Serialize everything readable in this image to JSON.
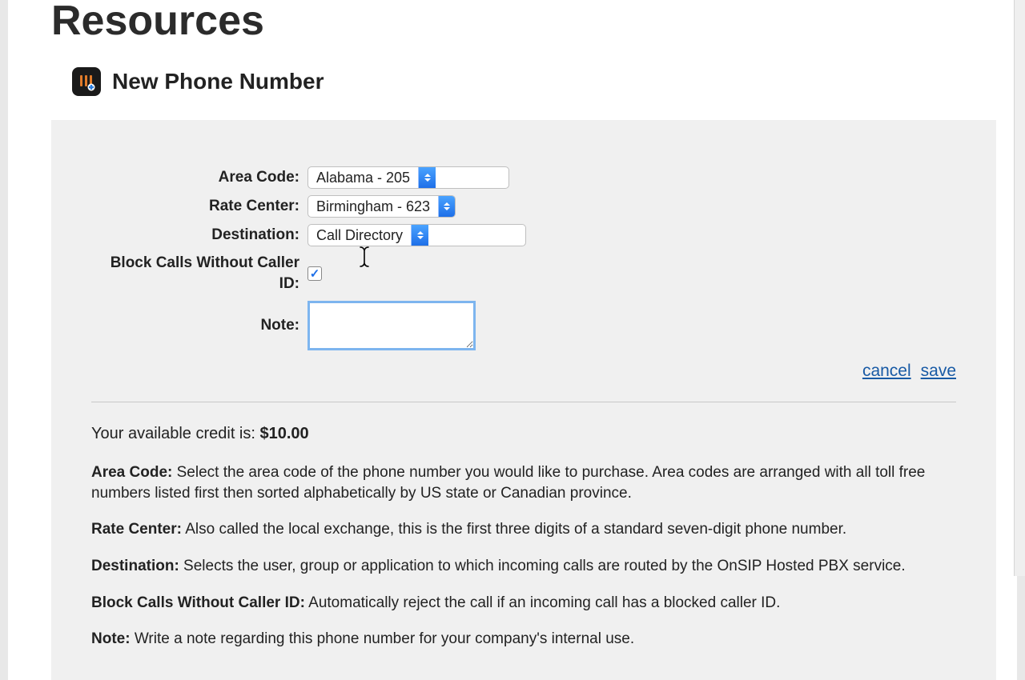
{
  "pageTitle": "Resources",
  "subtitle": "New Phone Number",
  "form": {
    "areaCode": {
      "label": "Area Code:",
      "value": "Alabama - 205"
    },
    "rateCenter": {
      "label": "Rate Center:",
      "value": "Birmingham - 623"
    },
    "destination": {
      "label": "Destination:",
      "value": "Call Directory"
    },
    "blockNoCID": {
      "label": "Block Calls Without Caller ID:",
      "checked": "✓"
    },
    "note": {
      "label": "Note:",
      "value": ""
    }
  },
  "actions": {
    "cancel": "cancel",
    "save": "save"
  },
  "credit": {
    "prefix": "Your available credit is: ",
    "amount": "$10.00"
  },
  "help": {
    "areaCode": {
      "term": "Area Code:",
      "text": " Select the area code of the phone number you would like to purchase. Area codes are arranged with all toll free numbers listed first then sorted alphabetically by US state or Canadian province."
    },
    "rateCenter": {
      "term": "Rate Center:",
      "text": " Also called the local exchange, this is the first three digits of a standard seven-digit phone number."
    },
    "destination": {
      "term": "Destination:",
      "text": " Selects the user, group or application to which incoming calls are routed by the OnSIP Hosted PBX service."
    },
    "blockNoCID": {
      "term": "Block Calls Without Caller ID:",
      "text": " Automatically reject the call if an incoming call has a blocked caller ID."
    },
    "note": {
      "term": "Note:",
      "text": " Write a note regarding this phone number for your company's internal use."
    }
  }
}
